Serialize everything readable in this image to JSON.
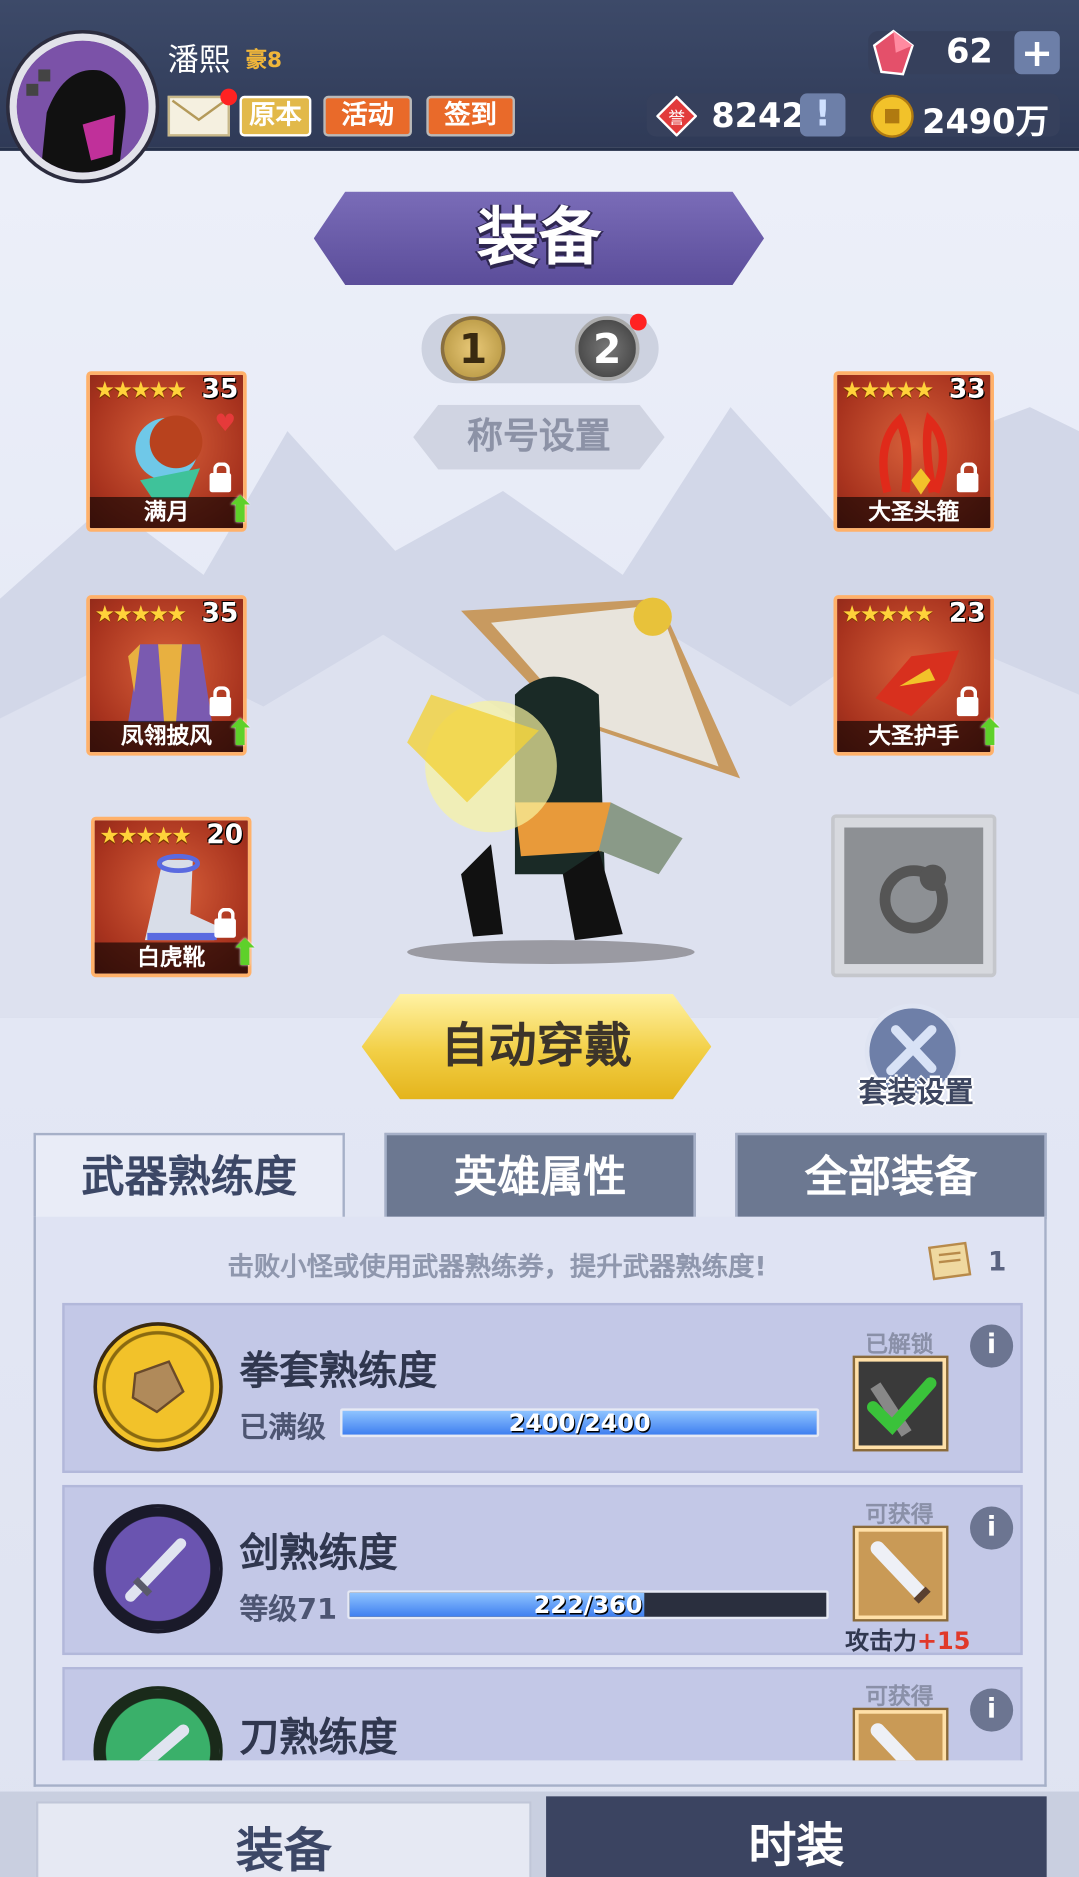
{
  "header": {
    "player_name": "潘熙",
    "vip_label": "豪8",
    "buttons": [
      "原本",
      "活动",
      "签到"
    ],
    "gems": "62",
    "honor": "8242",
    "coins": "2490万"
  },
  "page": {
    "title": "装备",
    "loadouts": [
      "1",
      "2"
    ],
    "title_setting": "称号设置"
  },
  "slots": [
    {
      "name": "满月",
      "level": "35",
      "stars": "★★★★★"
    },
    {
      "name": "凤翎披风",
      "level": "35",
      "stars": "★★★★★"
    },
    {
      "name": "白虎靴",
      "level": "20",
      "stars": "★★★★★"
    },
    {
      "name": "大圣头箍",
      "level": "33",
      "stars": "★★★★★"
    },
    {
      "name": "大圣护手",
      "level": "23",
      "stars": "★★★★★"
    }
  ],
  "actions": {
    "auto_equip": "自动穿戴",
    "suit_setting": "套装设置"
  },
  "tabs": [
    "武器熟练度",
    "英雄属性",
    "全部装备"
  ],
  "proficiency": {
    "hint": "击败小怪或使用武器熟练券，提升武器熟练度!",
    "ticket_count": "1",
    "items": [
      {
        "name": "拳套熟练度",
        "level_text": "已满级",
        "progress": "2400/2400",
        "ratio": 1.0,
        "status": "已解锁",
        "reward": ""
      },
      {
        "name": "剑熟练度",
        "level_text": "等级71",
        "progress": "222/360",
        "ratio": 0.617,
        "status": "可获得",
        "reward_label": "攻击力",
        "reward_value": "+15"
      },
      {
        "name": "刀熟练度",
        "level_text": "",
        "progress": "",
        "ratio": 0,
        "status": "可获得",
        "reward": ""
      }
    ]
  },
  "bottom_nav": [
    "装备",
    "时装"
  ],
  "colors": {
    "accent_green": "#5ed12a",
    "reward_red": "#e0392a",
    "slot_red": "#a8331e"
  }
}
